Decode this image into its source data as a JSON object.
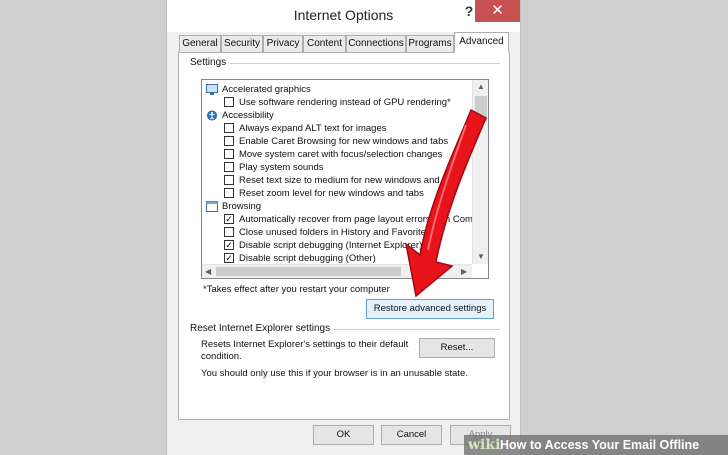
{
  "window": {
    "title": "Internet Options",
    "help_glyph": "?",
    "close_glyph": "✕"
  },
  "tabs": [
    "General",
    "Security",
    "Privacy",
    "Content",
    "Connections",
    "Programs",
    "Advanced"
  ],
  "active_tab": "Advanced",
  "settings": {
    "group_label": "Settings",
    "items": [
      {
        "type": "category",
        "label": "Accelerated graphics",
        "icon": "monitor-icon"
      },
      {
        "type": "checkbox",
        "label": "Use software rendering instead of GPU rendering*",
        "checked": false
      },
      {
        "type": "category",
        "label": "Accessibility",
        "icon": "accessibility-icon"
      },
      {
        "type": "checkbox",
        "label": "Always expand ALT text for images",
        "checked": false
      },
      {
        "type": "checkbox",
        "label": "Enable Caret Browsing for new windows and tabs",
        "checked": false
      },
      {
        "type": "checkbox",
        "label": "Move system caret with focus/selection changes",
        "checked": false
      },
      {
        "type": "checkbox",
        "label": "Play system sounds",
        "checked": false
      },
      {
        "type": "checkbox",
        "label": "Reset text size to medium for new windows and tabs",
        "checked": false
      },
      {
        "type": "checkbox",
        "label": "Reset zoom level for new windows and tabs",
        "checked": false
      },
      {
        "type": "category",
        "label": "Browsing",
        "icon": "browsing-icon"
      },
      {
        "type": "checkbox",
        "label": "Automatically recover from page layout errors with Compa",
        "checked": true
      },
      {
        "type": "checkbox",
        "label": "Close unused folders in History and Favorites*",
        "checked": false
      },
      {
        "type": "checkbox",
        "label": "Disable script debugging (Internet Explorer)",
        "checked": true
      },
      {
        "type": "checkbox",
        "label": "Disable script debugging (Other)",
        "checked": true
      }
    ],
    "note": "*Takes effect after you restart your computer",
    "restore_button": "Restore advanced settings"
  },
  "reset": {
    "group_label": "Reset Internet Explorer settings",
    "description": "Resets Internet Explorer's settings to their default condition.",
    "button": "Reset...",
    "warning": "You should only use this if your browser is in an unusable state."
  },
  "footer": {
    "ok": "OK",
    "cancel": "Cancel",
    "apply": "Apply"
  },
  "watermark": {
    "logo": "wiki",
    "text": "How to Access Your Email Offline"
  },
  "colors": {
    "close_button": "#c75050",
    "arrow": "#e8141c",
    "focus_border": "#5ea2d8"
  }
}
